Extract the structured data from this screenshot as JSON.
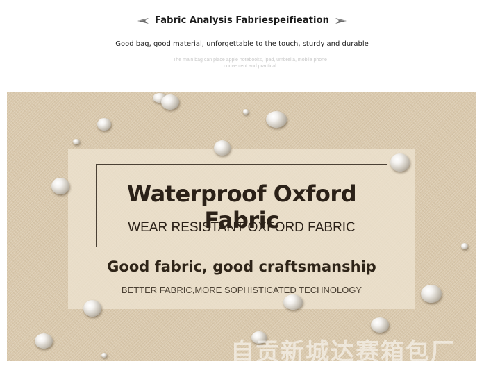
{
  "header": {
    "title": "Fabric Analysis Fabriespeifieation",
    "subtitle": "Good bag, good material, unforgettable to the touch, sturdy and durable",
    "faint_note_line1": "The main bag can place apple notebooks, ipad, umbrella, mobile phone",
    "faint_note_line2": "convenient and practical"
  },
  "banner": {
    "main_title": "Waterproof Oxford Fabric",
    "main_subtitle": "WEAR RESISTANT OXFORD  FABRIC",
    "tagline": "Good fabric, good craftsmanship",
    "tagline_sub": "BETTER FABRIC,MORE SOPHISTICATED TECHNOLOGY",
    "watermark": "自贡新城达赛箱包厂"
  },
  "colors": {
    "fabric": "#d9c8ac",
    "text_dark": "#2b2118"
  },
  "icons": [
    "feather-left-icon",
    "feather-right-icon"
  ]
}
